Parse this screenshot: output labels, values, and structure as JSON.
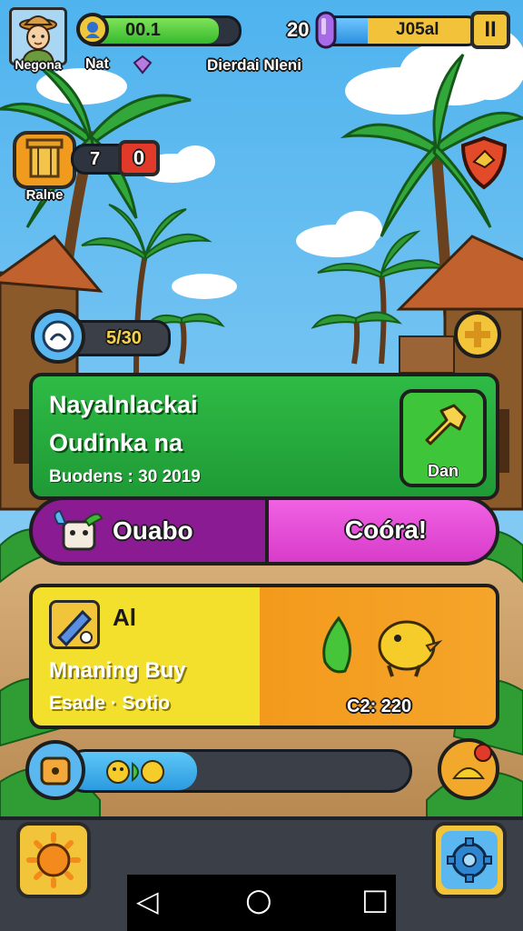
{
  "hud": {
    "avatar_name": "Negona",
    "xp_value": "00.1",
    "player_label": "Nat",
    "level_number": "20",
    "currency_value": "J05al",
    "pause_glyph": "II",
    "menu_label": "Dierdai Nleni",
    "xp_fill": 0.87,
    "currency_fill": 0.3
  },
  "side": {
    "shop_label": "Ralne",
    "shop_count": "7",
    "alert_count": "0",
    "energy_value": "5/30"
  },
  "quest": {
    "title": "Nayalnlackai",
    "subtitle": "Oudinka na",
    "date_line": "Buodens : 30  2019",
    "action_label": "Dan"
  },
  "split": {
    "left_label": "Ouabo",
    "right_label": "Coóra!"
  },
  "offer": {
    "title": "Al",
    "line1": "Mnaning Buy",
    "line2": "Esade · Sotio",
    "timer": "C2: 220"
  },
  "progress": {
    "fill": 0.38
  },
  "navbar": {
    "back": "◁",
    "home": "○",
    "recent": "□"
  },
  "colors": {
    "sky": "#57b8ef",
    "green_card": "#26ad3f",
    "magenta": "#e14bd4",
    "purple": "#8a1b92",
    "yellow": "#f0e12c",
    "orange": "#f39a1c"
  }
}
